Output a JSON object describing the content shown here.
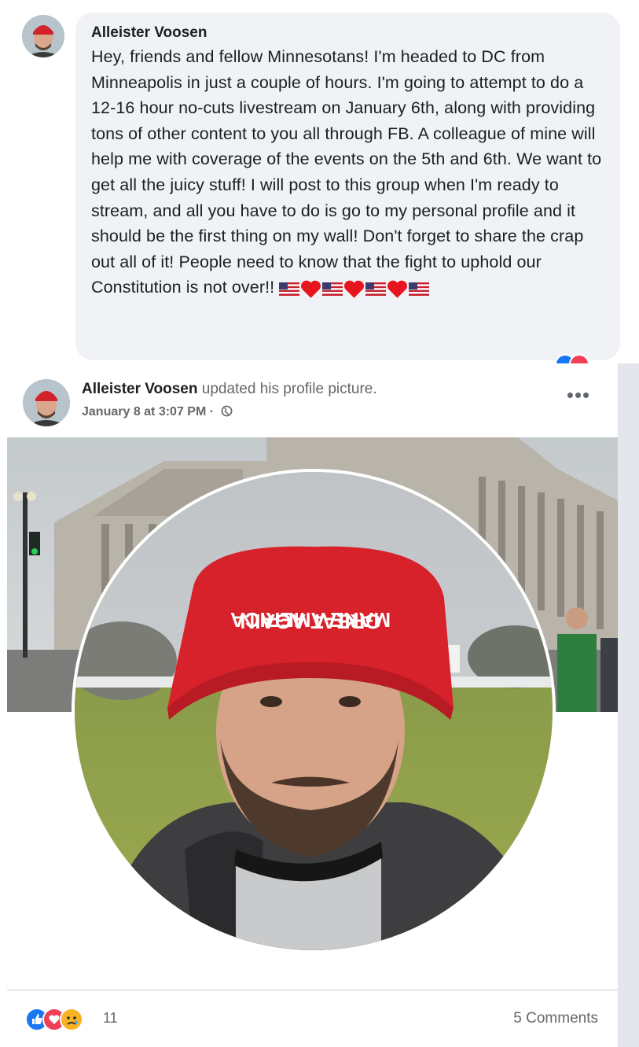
{
  "comment": {
    "author": "Alleister Voosen",
    "text": "Hey, friends and fellow Minnesotans! I'm headed to DC from Minneapolis in just a couple of hours. I'm going to attempt to do a 12-16 hour no-cuts livestream on January 6th, along with providing tons of other content to you all through FB. A colleague of mine will help me with coverage of the events on the 5th and 6th. We want to get all the juicy stuff! I will post to this group when I'm ready to stream, and all you have to do is go to my personal profile and it should be the first thing on my wall! Don't forget to share the crap out all of it! People need to know that the fight to uphold our Constitution is not over!!",
    "emoji_sequence": [
      "us-flag-icon",
      "red-heart-icon",
      "us-flag-icon",
      "red-heart-icon",
      "us-flag-icon",
      "red-heart-icon",
      "us-flag-icon"
    ]
  },
  "post": {
    "author": "Alleister Voosen",
    "action": "updated his profile picture.",
    "timestamp": "January 8 at 3:07 PM",
    "separator": "·",
    "more_label": "•••",
    "reaction_count": "11",
    "comments_label": "5 Comments",
    "reaction_icons": [
      "like-icon",
      "love-icon",
      "sad-icon"
    ]
  },
  "colors": {
    "bubble": "#f0f2f5",
    "like": "#1877f2",
    "love": "#f33e58",
    "sad": "#f7b125",
    "meta": "#65676b"
  }
}
